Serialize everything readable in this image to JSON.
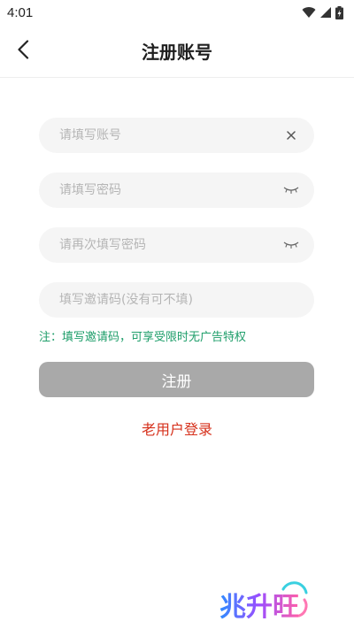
{
  "status_bar": {
    "time": "4:01"
  },
  "header": {
    "title": "注册账号"
  },
  "form": {
    "account_placeholder": "请填写账号",
    "password_placeholder": "请填写密码",
    "confirm_password_placeholder": "请再次填写密码",
    "invite_placeholder": "填写邀请码(没有可不填)",
    "note": "注：填写邀请码，可享受限时无广告特权",
    "register_label": "注册",
    "login_link": "老用户登录"
  },
  "watermark": {
    "text": "兆升旺"
  },
  "colors": {
    "note": "#1e9e6a",
    "login_link": "#d6311c",
    "register_button": "#a9a9a9",
    "field_background": "#f5f5f5"
  }
}
